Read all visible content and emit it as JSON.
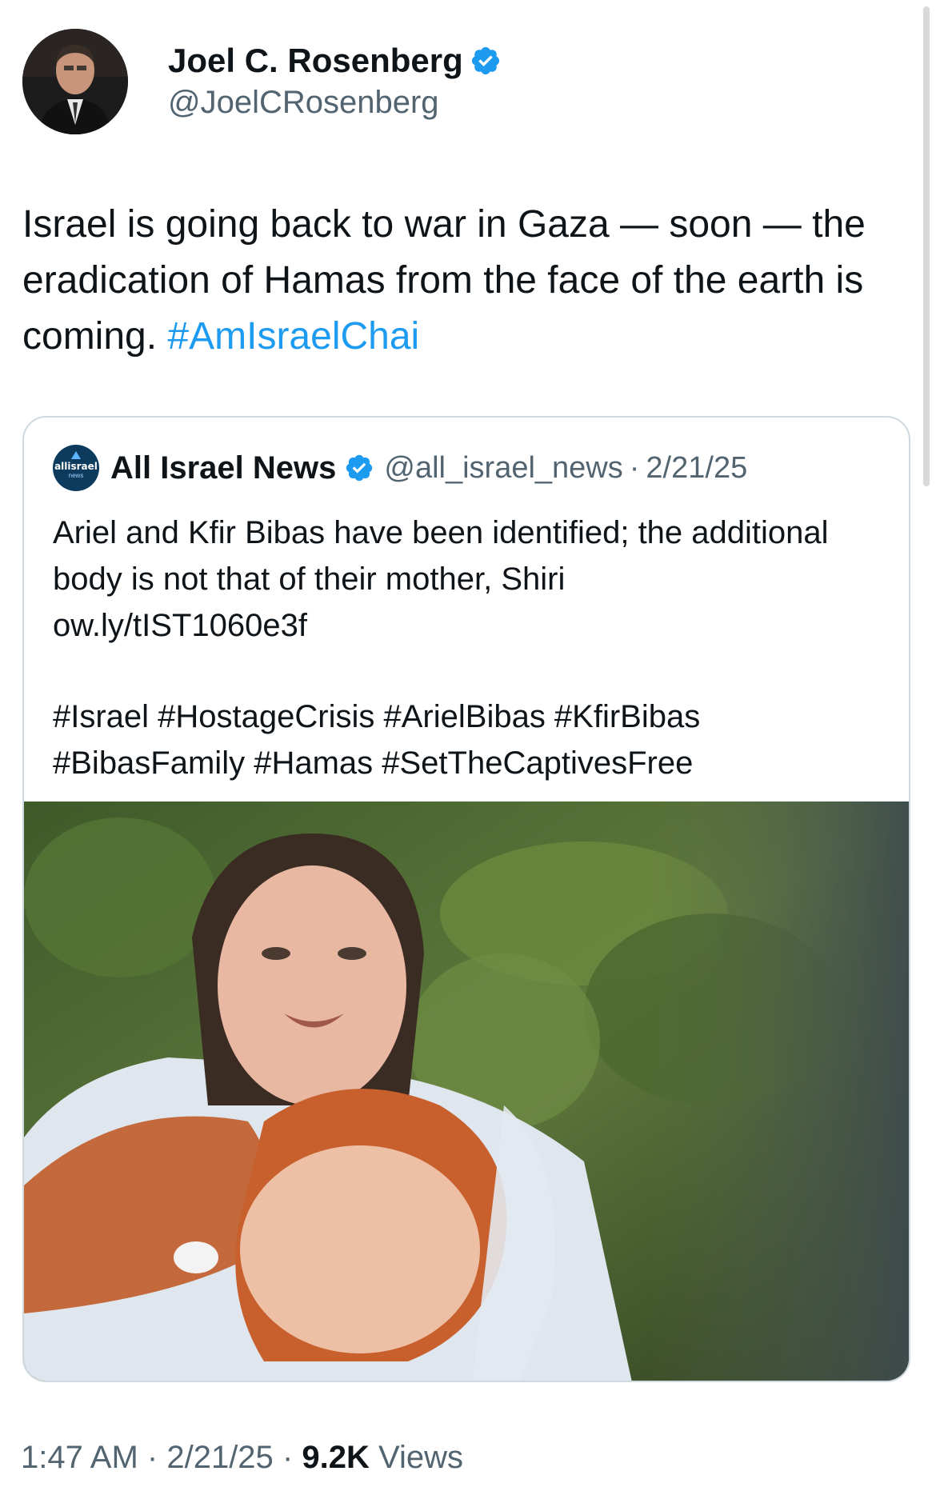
{
  "author": {
    "display_name": "Joel C. Rosenberg",
    "handle": "@JoelCRosenberg",
    "verified_icon": "verified-badge-icon"
  },
  "tweet": {
    "text": "Israel is going back to war in Gaza — soon — the eradication of Hamas from the face of the earth is coming. ",
    "hashtag": "#AmIsraelChai"
  },
  "quote": {
    "logo_text": "allisrael",
    "logo_sub": "news",
    "name": "All Israel News",
    "handle": "@all_israel_news",
    "separator": "·",
    "date": "2/21/25",
    "text": "Ariel and Kfir Bibas have been identified; the additional body is not that of their mother, Shiri",
    "link": "ow.ly/tIST1060e3f",
    "hashtags_line1": "#Israel #HostageCrisis #ArielBibas #KfirBibas",
    "hashtags_line2": "#BibasFamily #Hamas #SetTheCaptivesFree"
  },
  "meta": {
    "time": "1:47 AM",
    "sep1": "·",
    "date": "2/21/25",
    "sep2": "·",
    "views_count": "9.2K",
    "views_label": "Views"
  },
  "colors": {
    "link": "#1d9bf0",
    "secondary": "#536471",
    "primary": "#0f1419",
    "border": "#cfd9de"
  }
}
